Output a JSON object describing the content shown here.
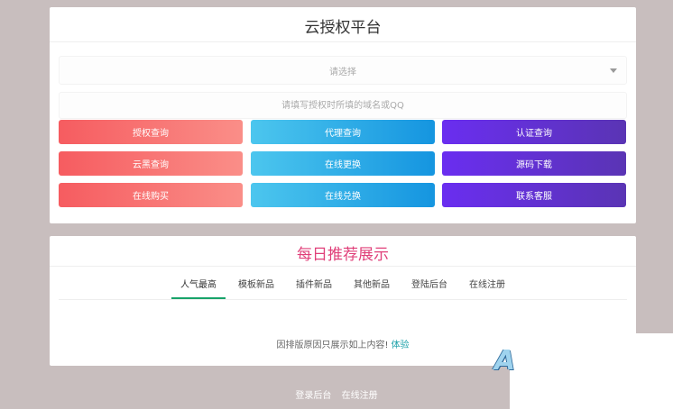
{
  "auth_card": {
    "title": "云授权平台",
    "select": {
      "placeholder": "请选择"
    },
    "domain_input": {
      "placeholder": "请填写授权时所填的域名或QQ"
    },
    "buttons": [
      {
        "label": "授权查询",
        "style": "red"
      },
      {
        "label": "代理查询",
        "style": "blue"
      },
      {
        "label": "认证查询",
        "style": "purple"
      },
      {
        "label": "云黑查询",
        "style": "red"
      },
      {
        "label": "在线更换",
        "style": "blue"
      },
      {
        "label": "源码下载",
        "style": "purple"
      },
      {
        "label": "在线购买",
        "style": "red"
      },
      {
        "label": "在线兑换",
        "style": "blue"
      },
      {
        "label": "联系客服",
        "style": "purple"
      }
    ]
  },
  "recommend_card": {
    "title": "每日推荐展示",
    "tabs": [
      {
        "label": "人气最高",
        "active": true
      },
      {
        "label": "模板新品",
        "active": false
      },
      {
        "label": "插件新品",
        "active": false
      },
      {
        "label": "其他新品",
        "active": false
      },
      {
        "label": "登陆后台",
        "active": false
      },
      {
        "label": "在线注册",
        "active": false
      }
    ],
    "notice_text": "因排版原因只展示如上内容!",
    "notice_link": "体验"
  },
  "footer": {
    "links": [
      "登录后台",
      "在线注册"
    ]
  },
  "watermark_letter": "A",
  "colors": {
    "page_bg": "#c8bebe",
    "red_start": "#f65c60",
    "blue_end": "#1595e0",
    "purple_start": "#6a2ef0",
    "recommend_title": "#e0407a",
    "active_tab_underline": "#17a36a",
    "link": "#1aa0a8"
  }
}
